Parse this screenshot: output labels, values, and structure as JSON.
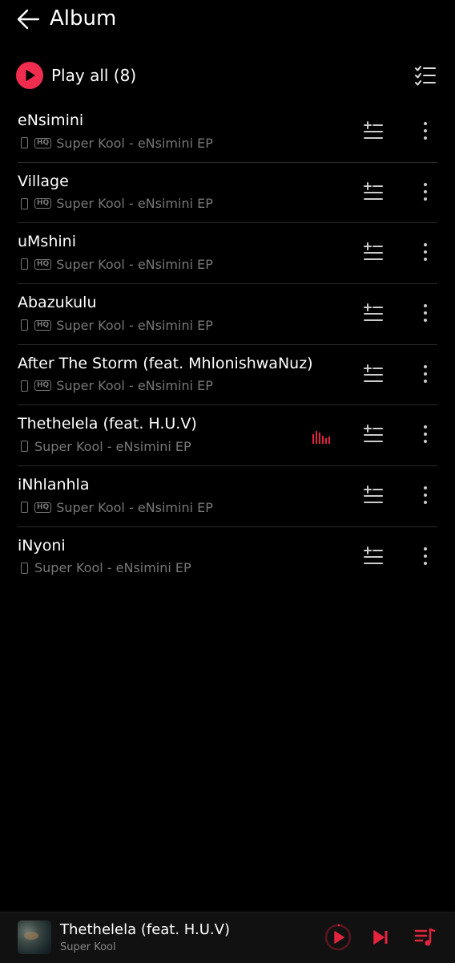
{
  "header": {
    "title": "Album",
    "back_icon": "arrow-left-icon"
  },
  "play_all": {
    "label": "Play all (8)",
    "accent": "#f02d4f",
    "icon": "play-icon",
    "multi_select_icon": "checklist-icon"
  },
  "tracks": [
    {
      "title": "eNsimini",
      "subtitle": "Super Kool - eNsimini EP",
      "hq": true,
      "playing": false
    },
    {
      "title": "Village",
      "subtitle": "Super Kool - eNsimini EP",
      "hq": true,
      "playing": false
    },
    {
      "title": "uMshini",
      "subtitle": "Super Kool - eNsimini EP",
      "hq": true,
      "playing": false
    },
    {
      "title": "Abazukulu",
      "subtitle": "Super Kool - eNsimini EP",
      "hq": true,
      "playing": false
    },
    {
      "title": "After The Storm (feat. MhlonishwaNuz)",
      "subtitle": "Super Kool - eNsimini EP",
      "hq": true,
      "playing": false
    },
    {
      "title": "Thethelela (feat. H.U.V)",
      "subtitle": "Super Kool - eNsimini EP",
      "hq": false,
      "playing": true
    },
    {
      "title": "iNhlanhla",
      "subtitle": "Super Kool - eNsimini EP",
      "hq": true,
      "playing": false
    },
    {
      "title": "iNyoni",
      "subtitle": "Super Kool - eNsimini EP",
      "hq": false,
      "playing": false
    }
  ],
  "hq_badge": "HQ",
  "now_playing": {
    "title": "Thethelela (feat. H.U.V)",
    "artist": "Super Kool",
    "accent": "#e3243c"
  }
}
